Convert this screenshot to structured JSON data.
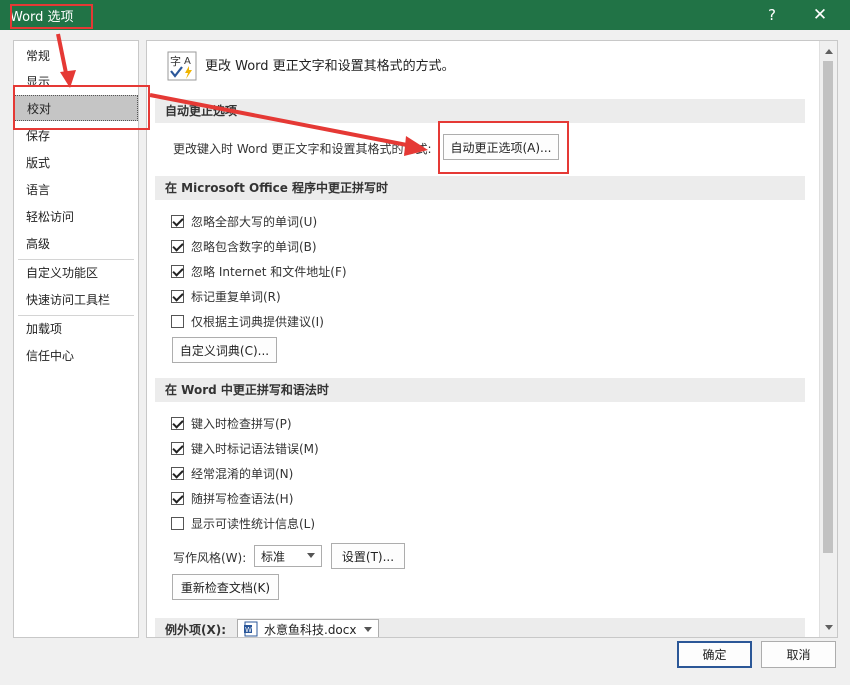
{
  "window": {
    "title": "Word 选项",
    "help": "?",
    "close": "✕"
  },
  "nav": {
    "items": [
      "常规",
      "显示",
      "校对",
      "保存",
      "版式",
      "语言",
      "轻松访问",
      "高级",
      "自定义功能区",
      "快速访问工具栏",
      "加载项",
      "信任中心"
    ],
    "active": "校对"
  },
  "header": {
    "text": "更改 Word 更正文字和设置其格式的方式。"
  },
  "autocorrect": {
    "section": "自动更正选项",
    "label": "更改键入时 Word 更正文字和设置其格式的方式:",
    "button": "自动更正选项(A)..."
  },
  "office_section": {
    "title": "在 Microsoft Office 程序中更正拼写时",
    "options": [
      {
        "label": "忽略全部大写的单词(U)",
        "checked": true
      },
      {
        "label": "忽略包含数字的单词(B)",
        "checked": true
      },
      {
        "label": "忽略 Internet 和文件地址(F)",
        "checked": true
      },
      {
        "label": "标记重复单词(R)",
        "checked": true
      },
      {
        "label": "仅根据主词典提供建议(I)",
        "checked": false
      }
    ],
    "dict_button": "自定义词典(C)..."
  },
  "word_section": {
    "title": "在 Word 中更正拼写和语法时",
    "options": [
      {
        "label": "键入时检查拼写(P)",
        "checked": true
      },
      {
        "label": "键入时标记语法错误(M)",
        "checked": true
      },
      {
        "label": "经常混淆的单词(N)",
        "checked": true
      },
      {
        "label": "随拼写检查语法(H)",
        "checked": true
      },
      {
        "label": "显示可读性统计信息(L)",
        "checked": false
      }
    ],
    "style_label": "写作风格(W):",
    "style_value": "标准",
    "settings_button": "设置(T)...",
    "recheck_button": "重新检查文档(K)"
  },
  "exceptions": {
    "label": "例外项(X):",
    "file": "水意鱼科技.docx"
  },
  "footer": {
    "ok": "确定",
    "cancel": "取消"
  },
  "colors": {
    "titlebar": "#217346",
    "annotation": "#e53935",
    "ok_border": "#2b5797"
  }
}
